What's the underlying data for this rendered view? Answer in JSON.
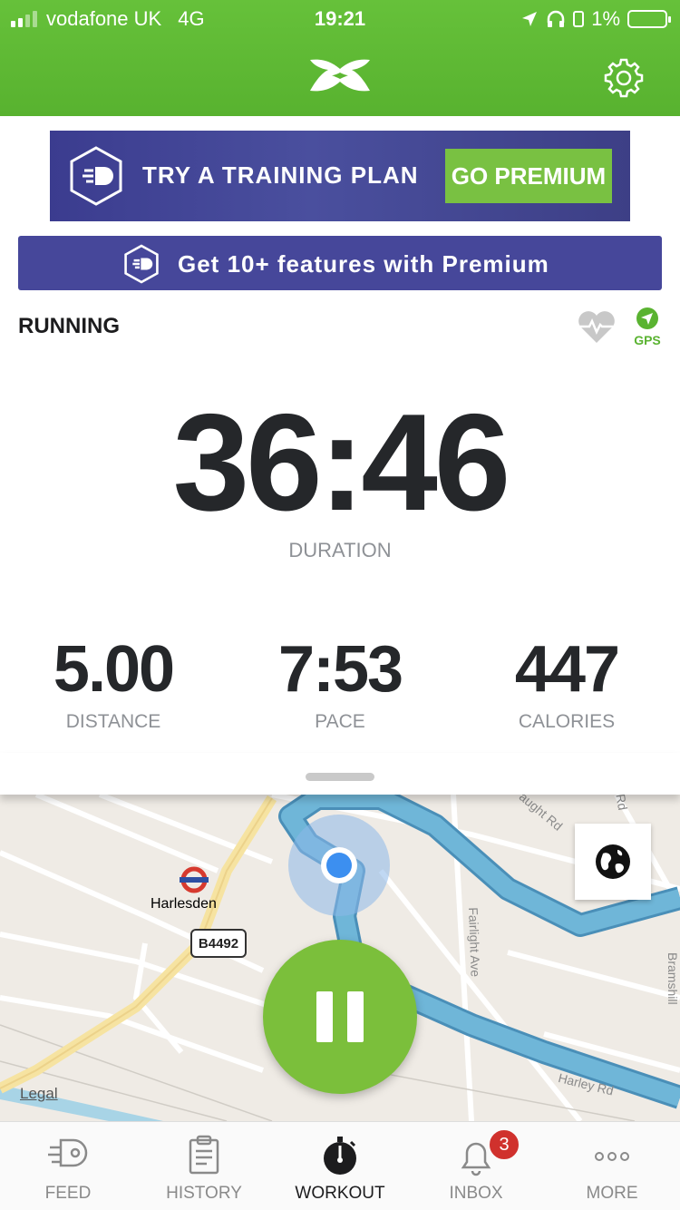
{
  "status": {
    "carrier": "vodafone UK",
    "network": "4G",
    "time": "19:21",
    "battery": "1%"
  },
  "promo": {
    "banner_text": "TRY A TRAINING PLAN",
    "banner_button": "GO PREMIUM",
    "strip_text": "Get 10+ features with Premium"
  },
  "activity": {
    "type": "RUNNING",
    "gps_label": "GPS"
  },
  "workout": {
    "duration": "36:46",
    "duration_label": "DURATION",
    "stats": [
      {
        "value": "5.00",
        "label": "DISTANCE"
      },
      {
        "value": "7:53",
        "label": "PACE"
      },
      {
        "value": "447",
        "label": "CALORIES"
      }
    ]
  },
  "map": {
    "place": "Harlesden",
    "road_shield": "B4492",
    "streets": [
      "Fairlight Ave",
      "Harley Rd",
      "aught Rd",
      "Rd",
      "Bramshill"
    ],
    "legal": "Legal"
  },
  "tabs": [
    {
      "label": "FEED",
      "icon": "feed-icon"
    },
    {
      "label": "HISTORY",
      "icon": "clipboard-icon"
    },
    {
      "label": "WORKOUT",
      "icon": "stopwatch-icon"
    },
    {
      "label": "INBOX",
      "icon": "bell-icon",
      "badge": "3"
    },
    {
      "label": "MORE",
      "icon": "ellipsis-icon"
    }
  ],
  "colors": {
    "brand_green": "#66c13a",
    "premium_purple": "#46479a",
    "route_blue": "#6fb6d8",
    "badge_red": "#d0312d"
  }
}
